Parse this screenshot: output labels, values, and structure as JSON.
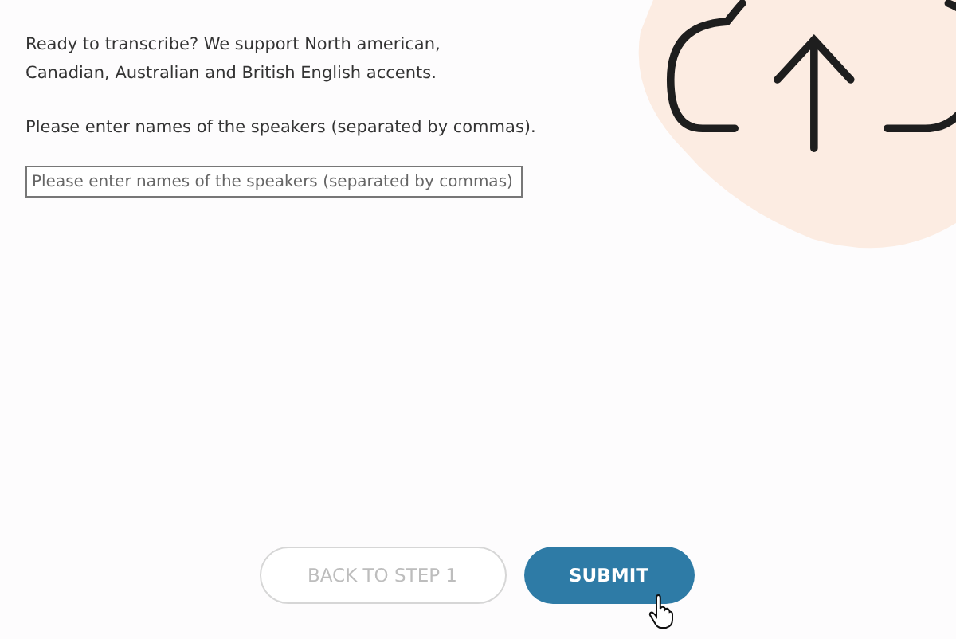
{
  "intro": "Ready to transcribe? We support North american,\nCanadian, Australian and British English accents.",
  "speakers_prompt": "Please enter names of the speakers (separated by commas).",
  "speakers_field": {
    "placeholder": "Please enter names of the speakers (separated by commas)"
  },
  "buttons": [
    {
      "label": "BACK TO STEP 1",
      "kind": "secondary"
    },
    {
      "label": "SUBMIT",
      "kind": "primary"
    }
  ]
}
